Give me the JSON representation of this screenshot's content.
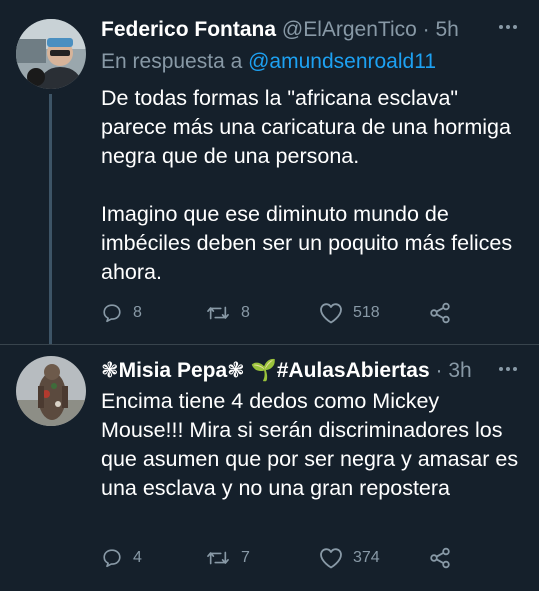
{
  "tweets": [
    {
      "name": "Federico Fontana",
      "handle": "@ElArgenTico",
      "time": "5h",
      "reply_prefix": "En respuesta a",
      "reply_handle": "@amundsenroald11",
      "paragraphs": [
        "De todas formas la \"africana esclava\" parece más una caricatura de una hormiga negra que de una persona.",
        "Imagino que ese diminuto mundo de imbéciles deben ser un poquito más felices ahora."
      ],
      "replies": "8",
      "retweets": "8",
      "likes": "518"
    },
    {
      "name": "❃Misia Pepa❃ 🌱#AulasAbiertas",
      "time": "3h",
      "text": "Encima tiene 4 dedos como Mickey Mouse!!! Mira si serán discriminadores los que asumen que por ser negra y amasar es una esclava y no una gran repostera",
      "replies": "4",
      "retweets": "7",
      "likes": "374"
    }
  ],
  "icons": [
    "reply-icon",
    "retweet-icon",
    "like-icon",
    "share-icon",
    "more-icon"
  ],
  "colors": {
    "background": "#15202b",
    "muted": "#8899a6",
    "link": "#1da1f2",
    "text": "#ffffff",
    "divider": "#38444d"
  }
}
